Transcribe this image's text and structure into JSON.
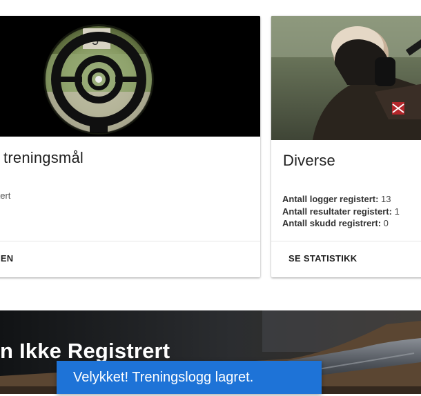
{
  "cards": [
    {
      "title": "te treningsmål",
      "text": "gistert",
      "action": "GGEN",
      "image": "scope-target-view"
    },
    {
      "title": "Diverse",
      "stats": [
        {
          "label": "Antall logger registert:",
          "value": "13"
        },
        {
          "label": "Antall resultater registert:",
          "value": "1"
        },
        {
          "label": "Antall skudd registrert:",
          "value": "0"
        }
      ],
      "action": "SE STATISTIKK",
      "image": "shooter-prone-rifle"
    }
  ],
  "banner": {
    "title": "n Ikke Registrert",
    "image": "rifle-barrel-closeup"
  },
  "snackbar": {
    "message": "Velykket! Treningslogg lagret.",
    "color": "#1e73d7"
  }
}
